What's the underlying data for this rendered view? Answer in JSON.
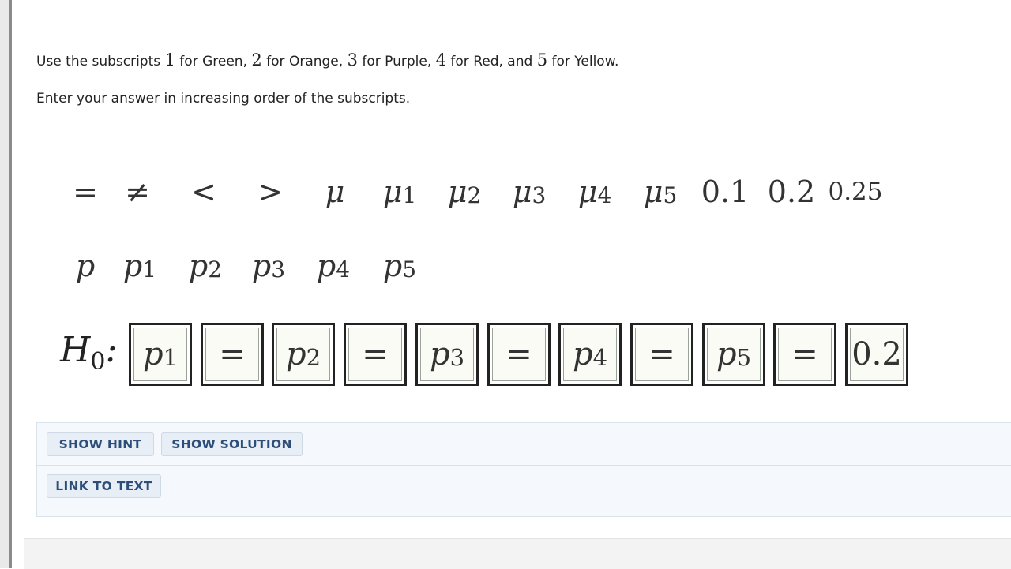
{
  "instructions": {
    "line1": [
      {
        "t": "Use the subscripts ",
        "num": false
      },
      {
        "t": "1",
        "num": true
      },
      {
        "t": " for Green, ",
        "num": false
      },
      {
        "t": "2",
        "num": true
      },
      {
        "t": " for Orange, ",
        "num": false
      },
      {
        "t": "3",
        "num": true
      },
      {
        "t": " for Purple, ",
        "num": false
      },
      {
        "t": "4",
        "num": true
      },
      {
        "t": " for Red, and ",
        "num": false
      },
      {
        "t": "5",
        "num": true
      },
      {
        "t": " for Yellow.",
        "num": false
      }
    ],
    "line2": "Enter your answer in increasing order of the subscripts."
  },
  "palette": {
    "row1": [
      {
        "name": "equals-tile",
        "sym": "=",
        "sub": ""
      },
      {
        "name": "not-equals-tile",
        "sym": "≠",
        "sub": ""
      },
      {
        "name": "less-than-tile",
        "sym": "<",
        "sub": ""
      },
      {
        "name": "greater-than-tile",
        "sym": ">",
        "sub": ""
      },
      {
        "name": "mu-tile",
        "sym": "μ",
        "sub": "",
        "italic": true
      },
      {
        "name": "mu1-tile",
        "sym": "μ",
        "sub": "1",
        "italic": true
      },
      {
        "name": "mu2-tile",
        "sym": "μ",
        "sub": "2",
        "italic": true
      },
      {
        "name": "mu3-tile",
        "sym": "μ",
        "sub": "3",
        "italic": true
      },
      {
        "name": "mu4-tile",
        "sym": "μ",
        "sub": "4",
        "italic": true
      },
      {
        "name": "mu5-tile",
        "sym": "μ",
        "sub": "5",
        "italic": true
      },
      {
        "name": "value-0-1-tile",
        "sym": "0.1",
        "sub": ""
      },
      {
        "name": "value-0-2-tile",
        "sym": "0.2",
        "sub": ""
      },
      {
        "name": "value-0-25-tile",
        "sym": "0.25",
        "sub": "",
        "small": true
      }
    ],
    "row2": [
      {
        "name": "p-tile",
        "sym": "p",
        "sub": "",
        "italic": true
      },
      {
        "name": "p1-tile",
        "sym": "p",
        "sub": "1",
        "italic": true
      },
      {
        "name": "p2-tile",
        "sym": "p",
        "sub": "2",
        "italic": true
      },
      {
        "name": "p3-tile",
        "sym": "p",
        "sub": "3",
        "italic": true
      },
      {
        "name": "p4-tile",
        "sym": "p",
        "sub": "4",
        "italic": true
      },
      {
        "name": "p5-tile",
        "sym": "p",
        "sub": "5",
        "italic": true
      }
    ]
  },
  "hypothesis": {
    "label": "H",
    "label_sub": "0",
    "label_colon": ":",
    "slots": [
      {
        "sym": "p",
        "sub": "1",
        "italic": true
      },
      {
        "sym": "=",
        "sub": ""
      },
      {
        "sym": "p",
        "sub": "2",
        "italic": true
      },
      {
        "sym": "=",
        "sub": ""
      },
      {
        "sym": "p",
        "sub": "3",
        "italic": true
      },
      {
        "sym": "=",
        "sub": ""
      },
      {
        "sym": "p",
        "sub": "4",
        "italic": true
      },
      {
        "sym": "=",
        "sub": ""
      },
      {
        "sym": "p",
        "sub": "5",
        "italic": true
      },
      {
        "sym": "=",
        "sub": ""
      },
      {
        "sym": "0.2",
        "sub": ""
      }
    ]
  },
  "buttons": {
    "show_hint": "SHOW HINT",
    "show_solution": "SHOW SOLUTION",
    "link_to_text": "LINK TO TEXT"
  }
}
